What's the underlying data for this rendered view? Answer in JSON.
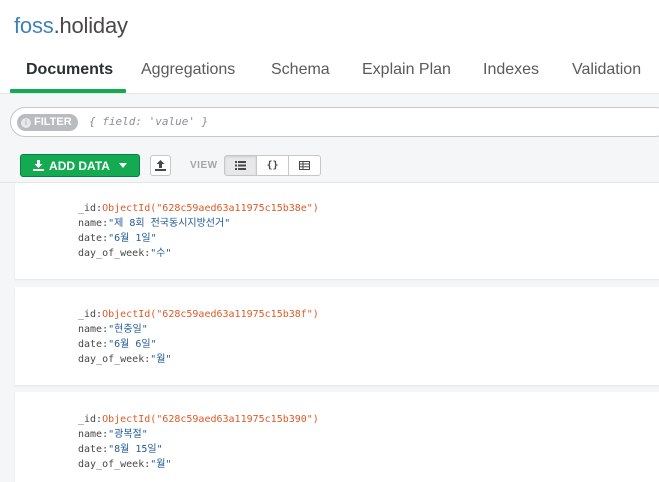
{
  "namespace": {
    "db": "foss",
    "collection": ".holiday"
  },
  "tabs": [
    {
      "label": "Documents",
      "active": true
    },
    {
      "label": "Aggregations"
    },
    {
      "label": "Schema"
    },
    {
      "label": "Explain Plan"
    },
    {
      "label": "Indexes"
    },
    {
      "label": "Validation"
    }
  ],
  "filter": {
    "label": "FILTER",
    "info": "i",
    "placeholder": "{ field: 'value' }"
  },
  "toolbar": {
    "add_data_label": "ADD DATA",
    "view_label": "VIEW",
    "view_modes": [
      "list-icon",
      "json-icon",
      "table-icon"
    ],
    "json_glyph": "{}"
  },
  "documents": [
    {
      "id_key": "_id:",
      "id_val": "ObjectId(\"628c59aed63a11975c15b38e\")",
      "name_key": "name:",
      "name_val": "\"제 8회 전국동시지방선거\"",
      "date_key": "date:",
      "date_val": "\"6월 1일\"",
      "dow_key": "day_of_week:",
      "dow_val": "\"수\""
    },
    {
      "id_key": "_id:",
      "id_val": "ObjectId(\"628c59aed63a11975c15b38f\")",
      "name_key": "name:",
      "name_val": "\"현충일\"",
      "date_key": "date:",
      "date_val": "\"6월 6일\"",
      "dow_key": "day_of_week:",
      "dow_val": "\"월\""
    },
    {
      "id_key": "_id:",
      "id_val": "ObjectId(\"628c59aed63a11975c15b390\")",
      "name_key": "name:",
      "name_val": "\"광복절\"",
      "date_key": "date:",
      "date_val": "\"8월 15일\"",
      "dow_key": "day_of_week:",
      "dow_val": "\"월\""
    }
  ],
  "colors": {
    "accent": "#13aa52",
    "db_name": "#3d82b8",
    "objectid": "#dd5a27",
    "string": "#1f5a96"
  }
}
